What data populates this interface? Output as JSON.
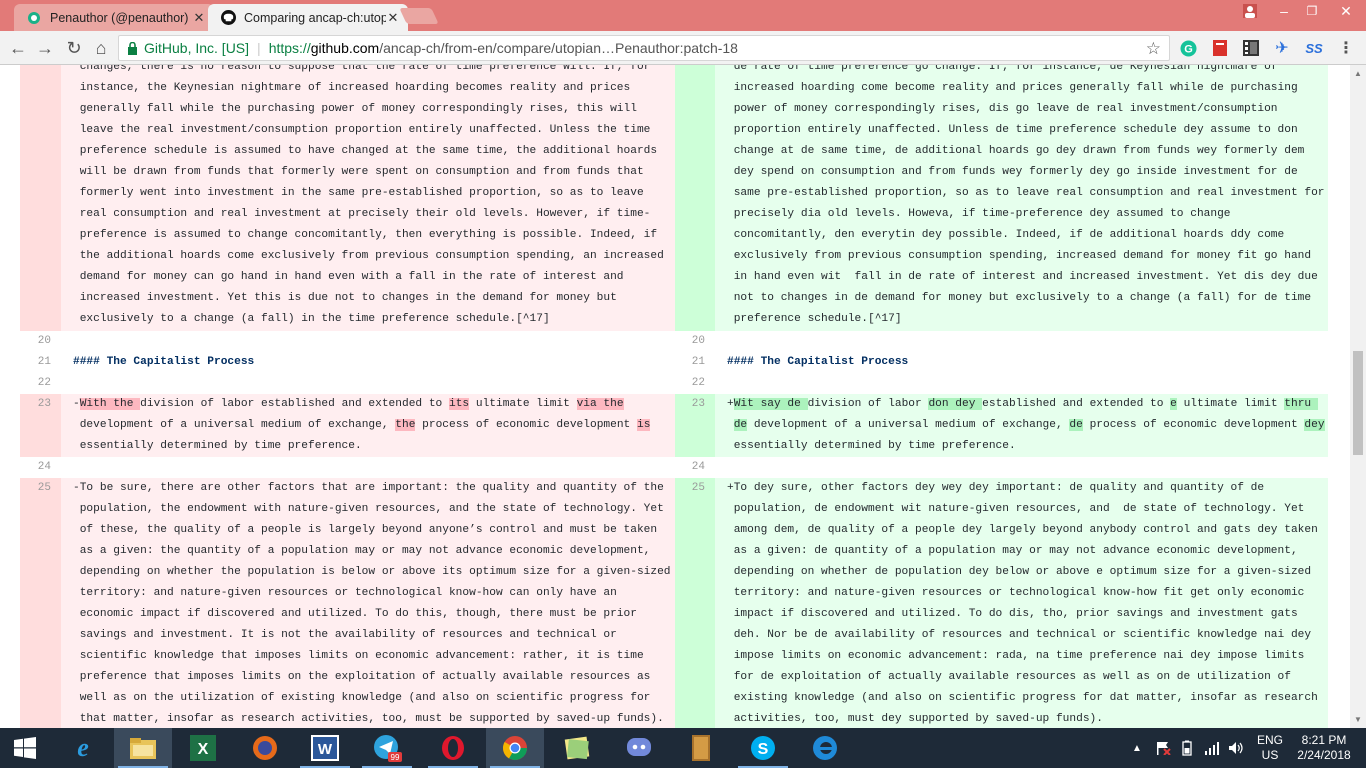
{
  "browser": {
    "tabs": [
      {
        "title": "Penauthor (@penauthor)",
        "active": false
      },
      {
        "title": "Comparing ancap-ch:utopian",
        "active": true
      }
    ],
    "window_controls": {
      "minimize": "–",
      "maximize": "❐",
      "close": "✕"
    },
    "address": {
      "site_identity": "GitHub, Inc. [US]",
      "protocol": "https://",
      "host": "github.com",
      "path": "/ancap-ch/from-en/compare/utopian…Penauthor:patch-18"
    }
  },
  "diff": {
    "top_left_lines": [
      "changes, there is no reason to suppose that the rate of time preference will. If, for",
      "instance, the Keynesian nightmare of increased hoarding becomes reality and prices",
      "generally fall while the purchasing power of money correspondingly rises, this will",
      "leave the real investment/consumption proportion entirely unaffected. Unless the time",
      "preference schedule is assumed to have changed at the same time, the additional hoards",
      "will be drawn from funds that formerly were spent on consumption and from funds that",
      "formerly went into investment in the same pre-established proportion, so as to leave",
      "real consumption and real investment at precisely their old levels. However, if time-",
      "preference is assumed to change concomitantly, then everything is possible. Indeed, if",
      "the additional hoards come exclusively from previous consumption spending, an increased",
      "demand for money can go hand in hand even with a fall in the rate of interest and",
      "increased investment. Yet this is due not to changes in the demand for money but",
      "exclusively to a change (a fall) in the time preference schedule.[^17]"
    ],
    "top_right_lines": [
      "de rate of time preference go change. If, for instance, de Keynesian nightmare of",
      "increased hoarding come become reality and prices generally fall while de purchasing",
      "power of money correspondingly rises, dis go leave de real investment/consumption",
      "proportion entirely unaffected. Unless de time preference schedule dey assume to don",
      "change at de same time, de additional hoards go dey drawn from funds wey formerly dem",
      "dey spend on consumption and from funds wey formerly dey go inside investment for de",
      "same pre-established proportion, so as to leave real consumption and real investment for",
      "precisely dia old levels. Howeva, if time-preference dey assumed to change",
      "concomitantly, den everytin dey possible. Indeed, if de additional hoards ddy come",
      "exclusively from previous consumption spending, increased demand for money fit go hand",
      "in hand even wit  fall in de rate of interest and increased investment. Yet dis dey due",
      "not to changes in de demand for money but exclusively to a change (a fall) for de time",
      "preference schedule.[^17]"
    ],
    "line20": {
      "num": "20",
      "text": ""
    },
    "line21": {
      "num": "21",
      "text": "#### The Capitalist Process"
    },
    "line22": {
      "num": "22",
      "text": ""
    },
    "line23": {
      "num": "23",
      "left_marker": "-",
      "right_marker": "+",
      "left_l1": [
        {
          "t": "With the ",
          "h": true
        },
        {
          "t": "division of labor established and extended to ",
          "h": false
        },
        {
          "t": "its",
          "h": true
        },
        {
          "t": " ultimate limit ",
          "h": false
        },
        {
          "t": "via the",
          "h": true
        }
      ],
      "left_l2": [
        {
          "t": "development of a universal medium of exchange, ",
          "h": false
        },
        {
          "t": "the",
          "h": true
        },
        {
          "t": " process of economic development ",
          "h": false
        },
        {
          "t": "is",
          "h": true
        }
      ],
      "left_l3": "essentially determined by time preference.",
      "right_l1": [
        {
          "t": "Wit say de ",
          "h": true
        },
        {
          "t": "division of labor ",
          "h": false
        },
        {
          "t": "don dey ",
          "h": true
        },
        {
          "t": "established and extended to ",
          "h": false
        },
        {
          "t": "e",
          "h": true
        },
        {
          "t": " ultimate limit ",
          "h": false
        },
        {
          "t": "thru ",
          "h": true
        }
      ],
      "right_l2": [
        {
          "t": "de",
          "h": true
        },
        {
          "t": " development of a universal medium of exchange, ",
          "h": false
        },
        {
          "t": "de",
          "h": true
        },
        {
          "t": " process of economic development ",
          "h": false
        },
        {
          "t": "dey",
          "h": true
        }
      ],
      "right_l3": "essentially determined by time preference."
    },
    "line24": {
      "num": "24",
      "text": ""
    },
    "line25": {
      "num": "25",
      "left_marker": "-",
      "right_marker": "+",
      "left_lines": [
        "To be sure, there are other factors that are important: the quality and quantity of the",
        "population, the endowment with nature-given resources, and the state of technology. Yet",
        "of these, the quality of a people is largely beyond anyone’s control and must be taken",
        "as a given: the quantity of a population may or may not advance economic development,",
        "depending on whether the population is below or above its optimum size for a given-sized",
        "territory: and nature-given resources or technological know-how can only have an",
        "economic impact if discovered and utilized. To do this, though, there must be prior",
        "savings and investment. It is not the availability of resources and technical or",
        "scientific knowledge that imposes limits on economic advancement: rather, it is time",
        "preference that imposes limits on the exploitation of actually available resources as",
        "well as on the utilization of existing knowledge (and also on scientific progress for",
        "that matter, insofar as research activities, too, must be supported by saved-up funds)."
      ],
      "right_lines": [
        "To dey sure, other factors dey wey dey important: de quality and quantity of de",
        "population, de endowment wit nature-given resources, and  de state of technology. Yet",
        "among dem, de quality of a people dey largely beyond anybody control and gats dey taken",
        "as a given: de quantity of a population may or may not advance economic development,",
        "depending on whether de population dey below or above e optimum size for a given-sized",
        "territory: and nature-given resources or technological know-how fit get only economic",
        "impact if discovered and utilized. To do dis, tho, prior savings and investment gats",
        "deh. Nor be de availability of resources and technical or scientific knowledge nai dey",
        "impose limits on economic advancement: rada, na time preference nai dey impose limits",
        "for de exploitation of actually available resources as well as on de utilization of",
        "existing knowledge (and also on scientific progress for dat matter, insofar as research",
        "activities, too, must dey supported by saved-up funds)."
      ]
    }
  },
  "taskbar": {
    "apps": [
      "start",
      "internet-explorer",
      "file-explorer",
      "excel",
      "firefox",
      "word",
      "telegram",
      "opera",
      "chrome",
      "sticky-notes",
      "discord",
      "books",
      "skype",
      "edge"
    ],
    "telegram_badge": "99",
    "tray": {
      "lang": "ENG",
      "region": "US",
      "time": "8:21 PM",
      "date": "2/24/2018"
    }
  },
  "colors": {
    "tabstrip": "#e27a78",
    "del_bg": "#ffeef0",
    "del_num_bg": "#ffdddd",
    "add_bg": "#e6ffed",
    "add_num_bg": "#cdffd8",
    "del_highlight": "#fdb8c0",
    "add_highlight": "#acf2bd",
    "heading_text": "#032f62"
  }
}
